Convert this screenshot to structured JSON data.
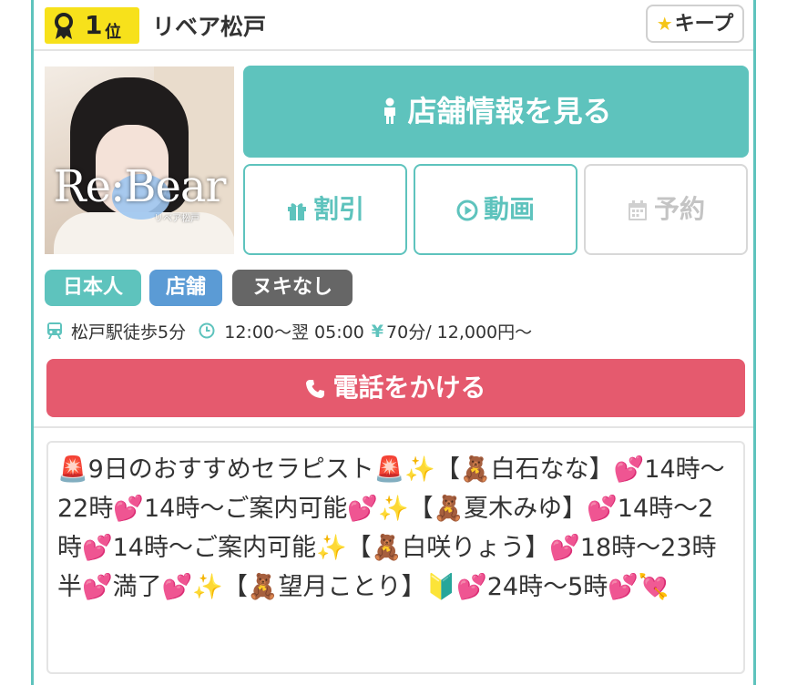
{
  "header": {
    "rank_number": "1",
    "rank_unit": "位",
    "rank_icon": "award-ribbon-icon",
    "shop_name": "リベア松戸",
    "keep_label": "キープ",
    "keep_icon": "star-icon"
  },
  "photo": {
    "logo_text": "Re:Bear",
    "sub_text": "リベア松戸"
  },
  "buttons": {
    "shop_info": "店舗情報を見る",
    "discount": "割引",
    "video": "動画",
    "reserve": "予約",
    "call": "電話をかける"
  },
  "tags": [
    {
      "label": "日本人",
      "color": "#5ec3bd"
    },
    {
      "label": "店舗",
      "color": "#5b9bd5"
    },
    {
      "label": "ヌキなし",
      "color": "#666666"
    }
  ],
  "info": {
    "access": "松戸駅徒歩5分",
    "hours": "12:00〜翌 05:00",
    "price": "70分∕ 12,000円〜",
    "yen_symbol": "¥"
  },
  "message": {
    "text": "🚨9日のおすすめセラピスト🚨✨【🧸白石なな】💕14時〜22時💕14時〜ご案内可能💕✨【🧸夏木みゆ】💕14時〜2時💕14時〜ご案内可能✨【🧸白咲りょう】💕18時〜23時半💕満了💕✨【🧸望月ことり】🔰💕24時〜5時💕💘"
  },
  "colors": {
    "accent": "#5ec3bd",
    "call": "#e55a6e",
    "rank_badge": "#f7e11b"
  }
}
